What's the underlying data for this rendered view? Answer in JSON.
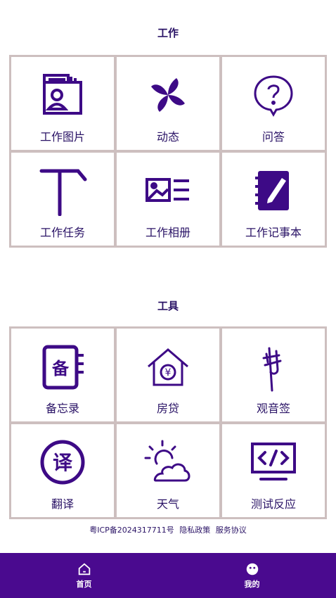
{
  "work": {
    "title": "工作",
    "items": [
      {
        "label": "工作图片",
        "icon": "photo-id-icon"
      },
      {
        "label": "动态",
        "icon": "pinwheel-icon"
      },
      {
        "label": "问答",
        "icon": "question-bubble-icon"
      },
      {
        "label": "工作任务",
        "icon": "tee-task-icon"
      },
      {
        "label": "工作相册",
        "icon": "album-list-icon"
      },
      {
        "label": "工作记事本",
        "icon": "notebook-pen-icon"
      }
    ]
  },
  "tools": {
    "title": "工具",
    "items": [
      {
        "label": "备忘录",
        "icon": "memo-book-icon",
        "glyph": "备"
      },
      {
        "label": "房贷",
        "icon": "house-yuan-icon",
        "glyph": "¥"
      },
      {
        "label": "观音签",
        "icon": "calligraphy-icon"
      },
      {
        "label": "翻译",
        "icon": "translate-circle-icon",
        "glyph": "译"
      },
      {
        "label": "天气",
        "icon": "sun-cloud-icon"
      },
      {
        "label": "测试反应",
        "icon": "code-monitor-icon"
      }
    ]
  },
  "footer": {
    "icp": "粤ICP备2024317711号",
    "privacy": "隐私政策",
    "agreement": "服务协议"
  },
  "tabbar": {
    "home": "首页",
    "mine": "我的"
  },
  "colors": {
    "accent": "#4a0a8f",
    "icon": "#3d0a86",
    "grid_border": "#cdbfbf"
  }
}
